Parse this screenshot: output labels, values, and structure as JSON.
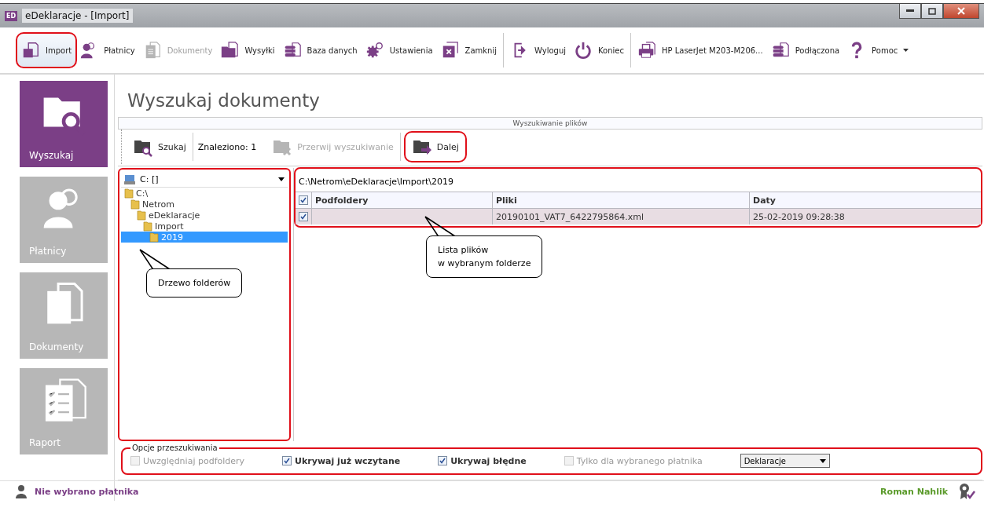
{
  "window": {
    "title": "eDeklaracje - [Import]",
    "icon_text": "ED"
  },
  "toolbar_groups": [
    [
      {
        "label": "Import",
        "kind": "import",
        "selected": true,
        "disabled": false,
        "annotated": true
      },
      {
        "label": "Płatnicy",
        "kind": "people",
        "selected": false,
        "disabled": false,
        "annotated": false
      },
      {
        "label": "Dokumenty",
        "kind": "documents",
        "selected": false,
        "disabled": true,
        "annotated": false
      },
      {
        "label": "Wysyłki",
        "kind": "folder",
        "selected": false,
        "disabled": false,
        "annotated": false
      },
      {
        "label": "Baza danych",
        "kind": "database",
        "selected": false,
        "disabled": false,
        "annotated": false
      },
      {
        "label": "Ustawienia",
        "kind": "gears",
        "selected": false,
        "disabled": false,
        "annotated": false
      },
      {
        "label": "Zamknij",
        "kind": "close",
        "selected": false,
        "disabled": false,
        "annotated": false
      }
    ],
    [
      {
        "label": "Wyloguj",
        "kind": "logout",
        "selected": false,
        "disabled": false,
        "annotated": false
      },
      {
        "label": "Koniec",
        "kind": "power",
        "selected": false,
        "disabled": false,
        "annotated": false
      }
    ],
    [
      {
        "label": "HP LaserJet M203-M206...",
        "kind": "printer",
        "selected": false,
        "disabled": false,
        "annotated": false
      },
      {
        "label": "Podłączona",
        "kind": "database",
        "selected": false,
        "disabled": false,
        "annotated": false
      },
      {
        "label": "Pomoc",
        "kind": "help",
        "selected": false,
        "disabled": false,
        "annotated": false,
        "dropdown": true
      }
    ]
  ],
  "nav": [
    {
      "label": "Wyszukaj",
      "kind": "search",
      "selected": true
    },
    {
      "label": "Płatnicy",
      "kind": "people",
      "selected": false
    },
    {
      "label": "Dokumenty",
      "kind": "documents",
      "selected": false
    },
    {
      "label": "Raport",
      "kind": "report",
      "selected": false
    }
  ],
  "heading": "Wyszukaj dokumenty",
  "section_label": "Wyszukiwanie plików",
  "search_toolbar": [
    {
      "kind": "search",
      "label": "Szukaj",
      "disabled": false,
      "annotated": false
    },
    {
      "kind": "text",
      "label": "Znaleziono: 1"
    },
    {
      "kind": "stop",
      "label": "Przerwij wyszukiwanie",
      "disabled": true,
      "annotated": false
    },
    {
      "kind": "next",
      "label": "Dalej",
      "disabled": false,
      "annotated": true
    }
  ],
  "tree": {
    "drive": "C: []",
    "annotated": true,
    "nodes": [
      {
        "label": "C:\\",
        "selected": false,
        "children": [
          {
            "label": "Netrom",
            "selected": false,
            "children": [
              {
                "label": "eDeklaracje",
                "selected": false,
                "children": [
                  {
                    "label": "Import",
                    "selected": false,
                    "children": [
                      {
                        "label": "2019",
                        "selected": true
                      }
                    ]
                  }
                ]
              }
            ]
          }
        ]
      }
    ]
  },
  "file_list": {
    "path": "C:\\Netrom\\eDeklaracje\\Import\\2019",
    "annotated": true,
    "all_checked": true,
    "columns": [
      "Podfoldery",
      "Pliki",
      "Daty"
    ],
    "rows": [
      {
        "checked": true,
        "selected": true,
        "file": "20190101_VAT7_6422795864.xml",
        "date": "25-02-2019 09:28:38"
      }
    ]
  },
  "callouts": [
    {
      "text": "Drzewo folderów"
    },
    {
      "text": "Lista plików\nw wybranym folderze"
    }
  ],
  "options": {
    "legend": "Opcje przeszukiwania",
    "annotated": true,
    "checkboxes": [
      {
        "label": "Uwzględniaj podfoldery",
        "checked": false,
        "disabled": true,
        "bold": false
      },
      {
        "label": "Ukrywaj już wczytane",
        "checked": true,
        "disabled": false,
        "bold": true
      },
      {
        "label": "Ukrywaj błędne",
        "checked": true,
        "disabled": false,
        "bold": true
      },
      {
        "label": "Tylko dla wybranego płatnika",
        "checked": false,
        "disabled": true,
        "bold": false
      }
    ],
    "select": "Deklaracje"
  },
  "status_bar": {
    "left": "Nie wybrano płatnika",
    "right": "Roman Nahlik"
  }
}
